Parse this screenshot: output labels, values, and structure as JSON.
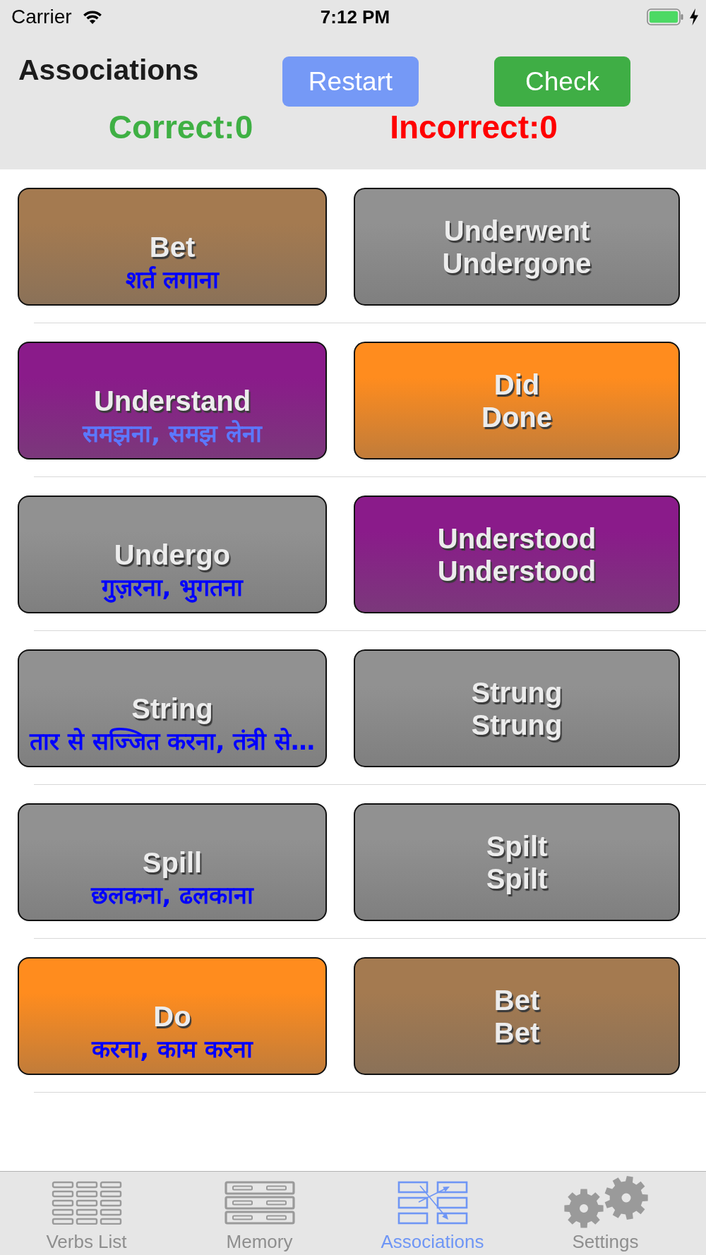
{
  "status_bar": {
    "carrier": "Carrier",
    "time": "7:12 PM"
  },
  "header": {
    "title": "Associations",
    "buttons": [
      {
        "kind": "restart",
        "label": "Restart"
      },
      {
        "kind": "check",
        "label": "Check"
      }
    ],
    "scores": [
      {
        "kind": "correct",
        "label": "Correct:0"
      },
      {
        "kind": "incorrect",
        "label": "Incorrect:0"
      }
    ]
  },
  "rows": [
    {
      "cards": [
        {
          "kind": "verb",
          "word": "Bet",
          "translation": "शर्त लगाना",
          "color": "#a47a50"
        },
        {
          "kind": "forms",
          "lines": [
            "Underwent",
            "Undergone"
          ],
          "color": "#919191"
        }
      ]
    },
    {
      "cards": [
        {
          "kind": "verb",
          "word": "Understand",
          "translation": "समझना, समझ लेना",
          "color": "#8a1b8a"
        },
        {
          "kind": "forms",
          "lines": [
            "Did",
            "Done"
          ],
          "color": "#ff8c1e"
        }
      ]
    },
    {
      "cards": [
        {
          "kind": "verb",
          "word": "Undergo",
          "translation": "गुज़रना, भुगतना",
          "color": "#919191"
        },
        {
          "kind": "forms",
          "lines": [
            "Understood",
            "Understood"
          ],
          "color": "#8a1b8a"
        }
      ]
    },
    {
      "cards": [
        {
          "kind": "verb",
          "word": "String",
          "translation": "तार से सज्जित करना, तंत्री से…",
          "color": "#919191"
        },
        {
          "kind": "forms",
          "lines": [
            "Strung",
            "Strung"
          ],
          "color": "#919191"
        }
      ]
    },
    {
      "cards": [
        {
          "kind": "verb",
          "word": "Spill",
          "translation": "छलकना, ढलकाना",
          "color": "#919191"
        },
        {
          "kind": "forms",
          "lines": [
            "Spilt",
            "Spilt"
          ],
          "color": "#919191"
        }
      ]
    },
    {
      "cards": [
        {
          "kind": "verb",
          "word": "Do",
          "translation": "करना, काम करना",
          "color": "#ff8c1e"
        },
        {
          "kind": "forms",
          "lines": [
            "Bet",
            "Bet"
          ],
          "color": "#a47a50"
        }
      ]
    }
  ],
  "tab_bar": {
    "tabs": [
      {
        "label": "Verbs List",
        "selected": false
      },
      {
        "label": "Memory",
        "selected": false
      },
      {
        "label": "Associations",
        "selected": true
      },
      {
        "label": "Settings",
        "selected": false
      }
    ]
  }
}
